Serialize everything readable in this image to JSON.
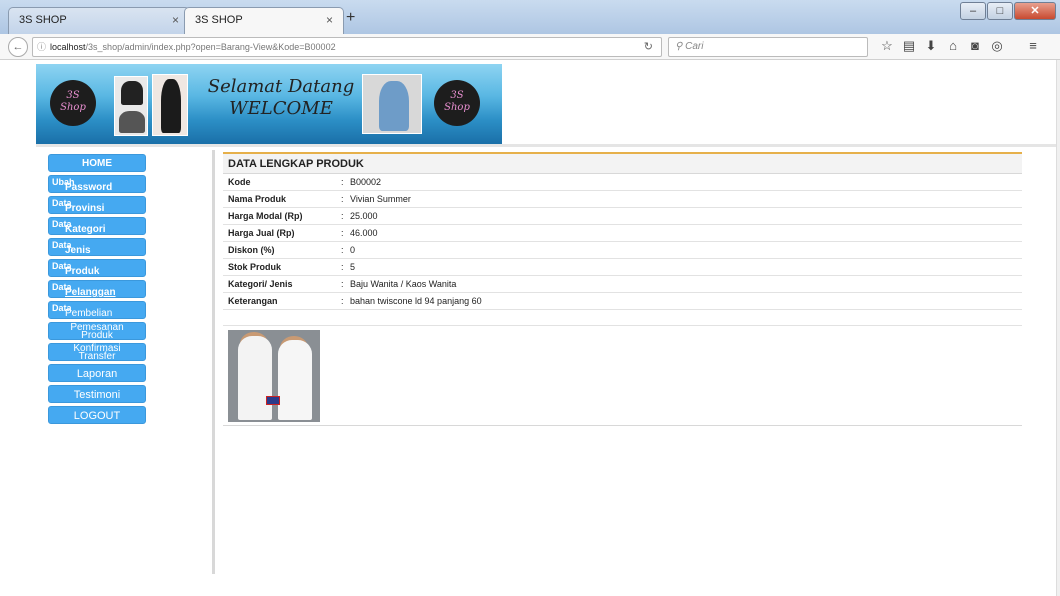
{
  "browser": {
    "tabs": [
      {
        "label": "3S SHOP",
        "active": false
      },
      {
        "label": "3S SHOP",
        "active": true
      }
    ],
    "new_tab_glyph": "+",
    "tab_close_glyph": "×",
    "url_host": "localhost",
    "url_path": "/3s_shop/admin/index.php?open=Barang-View&Kode=B00002",
    "search_placeholder": "Cari",
    "toolbar_icons": [
      "star-icon",
      "bookmarks-icon",
      "download-icon",
      "home-icon",
      "pocket-icon",
      "sync-icon",
      "menu-icon"
    ],
    "window_controls": [
      "minimize",
      "maximize",
      "close"
    ]
  },
  "banner": {
    "logo_text_top": "3S",
    "logo_text_bottom": "Shop",
    "welcome_line1": "Selamat Datang",
    "welcome_line2": "WELCOME"
  },
  "sidebar": {
    "items": [
      {
        "label": "HOME"
      },
      {
        "small": "Ubah",
        "label": "Password"
      },
      {
        "small": "Data",
        "label": "Provinsi"
      },
      {
        "small": "Data",
        "label": "Kategori"
      },
      {
        "small": "Data",
        "label": "Jenis"
      },
      {
        "small": "Data",
        "label": "Produk"
      },
      {
        "small": "Data",
        "label": "Pelanggan"
      },
      {
        "small": "Data",
        "label": "Pembelian"
      },
      {
        "line1": "Pemesanan",
        "line2": "Produk"
      },
      {
        "line1": "Konfirmasi",
        "line2": "Transfer"
      },
      {
        "label": "Laporan"
      },
      {
        "label": "Testimoni"
      },
      {
        "label": "LOGOUT"
      }
    ]
  },
  "content": {
    "title": "DATA LENGKAP PRODUK",
    "separator": ":",
    "rows": [
      {
        "key": "Kode",
        "value": "B00002"
      },
      {
        "key": "Nama Produk",
        "value": "Vivian Summer"
      },
      {
        "key": "Harga Modal (Rp)",
        "value": "25.000"
      },
      {
        "key": "Harga Jual (Rp)",
        "value": "46.000"
      },
      {
        "key": "Diskon (%)",
        "value": "0"
      },
      {
        "key": "Stok Produk",
        "value": "5"
      },
      {
        "key": "Kategori/ Jenis",
        "value": "Baju Wanita / Kaos Wanita"
      },
      {
        "key": "Keterangan",
        "value": "bahan twiscone ld 94 panjang 60"
      }
    ]
  },
  "colors": {
    "sidebar_button": "#45a9f1",
    "title_rule": "#e6b04a"
  }
}
